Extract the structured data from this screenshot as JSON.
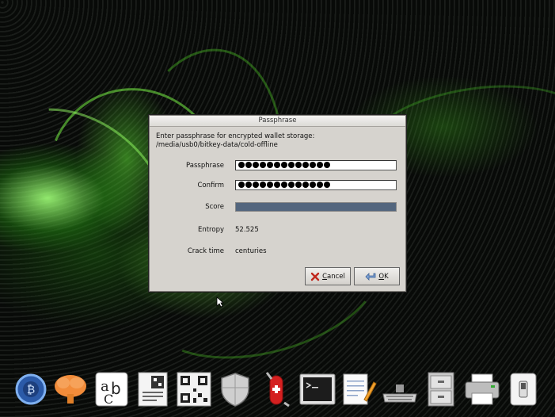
{
  "dialog": {
    "title": "Passphrase",
    "prompt_line1": "Enter passphrase for encrypted wallet storage:",
    "prompt_line2": "/media/usb0/bitkey-data/cold-offline",
    "passphrase_label": "Passphrase",
    "passphrase_mask_count": 13,
    "confirm_label": "Confirm",
    "confirm_mask_count": 13,
    "score_label": "Score",
    "score_bar_fraction": 1.0,
    "score_color": "#53667e",
    "entropy_label": "Entropy",
    "entropy_value": "52.525",
    "crack_label": "Crack time",
    "crack_value": "centuries",
    "cancel_accel": "C",
    "cancel_rest": "ancel",
    "ok_accel": "O",
    "ok_rest": "K"
  },
  "dock": {
    "icons": [
      "electrum-bitcoin-icon",
      "brain-wallet-icon",
      "font-ab-icon",
      "qr-document-icon",
      "qr-code-icon",
      "shield-icon",
      "swiss-knife-icon",
      "terminal-icon",
      "text-editor-icon",
      "keyboard-icon",
      "file-cabinet-icon",
      "printer-icon",
      "power-switch-icon"
    ]
  }
}
